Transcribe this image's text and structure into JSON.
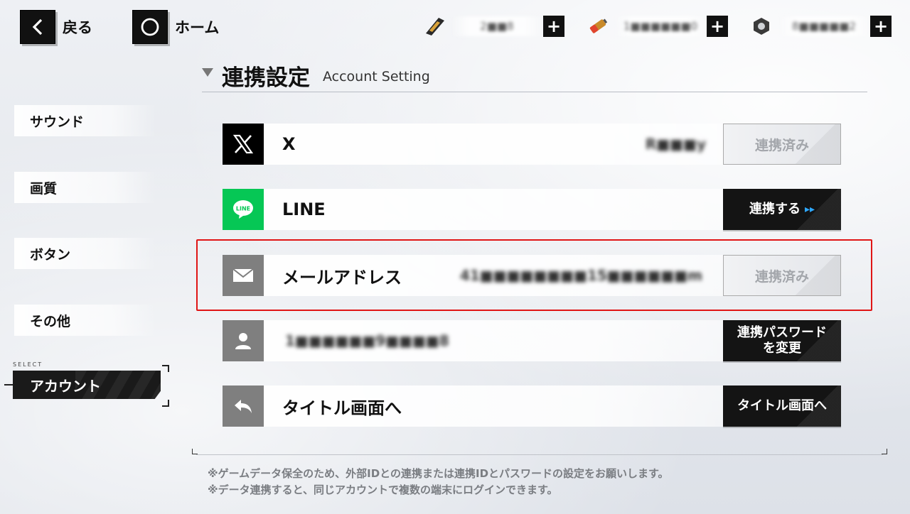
{
  "topbar": {
    "back_label": "戻る",
    "home_label": "ホーム",
    "resources": [
      {
        "icon": "ticket-icon",
        "value": "2■■8"
      },
      {
        "icon": "battery-icon",
        "value": "1■■■■■■0"
      },
      {
        "icon": "hex-nut-icon",
        "value": "8■■■■■2"
      }
    ],
    "plus_symbol": "+"
  },
  "sidebar": {
    "items": [
      "サウンド",
      "画質",
      "ボタン",
      "その他"
    ],
    "select_tag": "SELECT",
    "active_item": "アカウント"
  },
  "heading": {
    "title": "連携設定",
    "subtitle": "Account Setting"
  },
  "rows": [
    {
      "name": "x",
      "label": "X",
      "value": "R■■■y",
      "action": "連携済み",
      "action_state": "linked",
      "icon": "x-logo-icon",
      "icon_bg": "#000000"
    },
    {
      "name": "line",
      "label": "LINE",
      "value": "",
      "action": "連携する",
      "action_arrow": "▸▸",
      "action_state": "link",
      "icon": "line-logo-icon",
      "icon_bg": "#06C755"
    },
    {
      "name": "email",
      "label": "メールアドレス",
      "value": "41■■■■■■■■15■■■■■■m",
      "action": "連携済み",
      "action_state": "linked",
      "icon": "mail-icon",
      "icon_bg": "#7f7f7f"
    },
    {
      "name": "user-id",
      "label": "",
      "value": "1■■■■■■9■■■■8",
      "action_line1": "連携パスワード",
      "action_line2": "を変更",
      "action_state": "change",
      "icon": "user-icon",
      "icon_bg": "#7f7f7f"
    },
    {
      "name": "title-screen",
      "label": "タイトル画面へ",
      "value": "",
      "action": "タイトル画面へ",
      "action_state": "link",
      "icon": "return-arrow-icon",
      "icon_bg": "#7f7f7f"
    }
  ],
  "notes": [
    "※ゲームデータ保全のため、外部IDとの連携または連携IDとパスワードの設定をお願いします。",
    "※データ連携すると、同じアカウントで複数の端末にログインできます。"
  ],
  "colors": {
    "highlight": "#E01515",
    "line_green": "#06C755",
    "accent_arrow": "#2EA8FF"
  }
}
